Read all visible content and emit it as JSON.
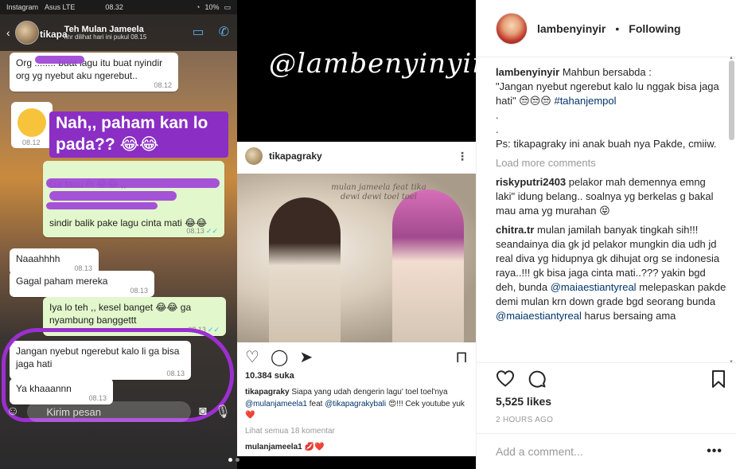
{
  "image": {
    "status_left": "Instagram",
    "status_carrier": "Asus  LTE",
    "status_time": "08.32",
    "status_battery": "10%",
    "wa_contact": "Teh Mulan Jameela",
    "wa_subtitle": "khr dilihat hari ini pukul 08.15",
    "wa_overlay_name": "tikapa",
    "messages": [
      {
        "text": "Org ........ buat lagu itu buat nyindir org yg nyebut aku ngerebut..",
        "time": "08.12"
      },
      {
        "text": "",
        "time": "08.12"
      },
      {
        "text": "Ga tauu ih 😂😂 ,,\n\n\n sindir balik pake lagu cinta mati 😂😂",
        "time": "08.13"
      },
      {
        "text": "Naaahhhh",
        "time": "08.13"
      },
      {
        "text": "Gagal paham mereka",
        "time": "08.13"
      },
      {
        "text": "Iya lo teh ,, kesel banget 😂😂 ga nyambung banggettt",
        "time": "08.13"
      },
      {
        "text": "Jangan nyebut ngerebut kalo li ga bisa jaga hati",
        "time": "08.13"
      },
      {
        "text": "Ya khaaannn",
        "time": "08.13"
      }
    ],
    "purple_text": "Nah,, paham kan lo pada?? 😂😂",
    "wa_input_placeholder": "Kirim pesan",
    "brand_text": "@lambenyinyir",
    "embedded_user": "tikapagraky",
    "embedded_caption_overlay": "mulan jameela feat tika dewi dewi toel toel",
    "embedded_likes": "10.384 suka",
    "embedded_caption_user": "tikapagraky",
    "embedded_caption_text": "Siapa yang udah dengerin lagu' toel toel'nya",
    "embedded_caption_tag1": "@mulanjameela1",
    "embedded_caption_feat": "feat",
    "embedded_caption_tag2": "@tikapagrakybali",
    "embedded_caption_end": "😍!!! Cek youtube yuk❤️",
    "embedded_view_all": "Lihat semua 18 komentar",
    "embedded_comment_user": "mulanjameela1",
    "embedded_comment_text": "💋❤️"
  },
  "header": {
    "username": "lambenyinyir",
    "separator": "•",
    "follow_status": "Following"
  },
  "caption": {
    "username": "lambenyinyir",
    "line1": "Mahbun bersabda :",
    "line2": "\"Jangan nyebut ngerebut kalo lu nggak bisa jaga hati\" 😒😒😒",
    "hashtag": "#tahanjempol",
    "dot1": ".",
    "dot2": ".",
    "ps": "Ps: tikapagraky ini anak buah nya Pakde, cmiiw."
  },
  "load_more": "Load more comments",
  "comments": [
    {
      "user": "riskyputri2403",
      "text": "pelakor mah demennya emng laki\" idung belang.. soalnya yg berkelas g bakal mau ama yg murahan 😝"
    },
    {
      "user": "chitra.tr",
      "text": "mulan jamilah banyak tingkah sih!!! seandainya dia gk jd pelakor mungkin dia udh jd real diva yg hidupnya gk dihujat org se indonesia raya..!!! gk bisa jaga cinta mati..??? yakin bgd deh, bunda",
      "mention1": "@maiaestiantyreal",
      "text2": "melepaskan pakde demi mulan krn down grade bgd seorang bunda",
      "mention2": "@maiaestiantyreal",
      "text3": "harus bersaing ama"
    }
  ],
  "actions": {
    "likes": "5,525 likes",
    "time_ago": "2 HOURS AGO"
  },
  "add_comment": {
    "placeholder": "Add a comment...",
    "more": "•••"
  }
}
